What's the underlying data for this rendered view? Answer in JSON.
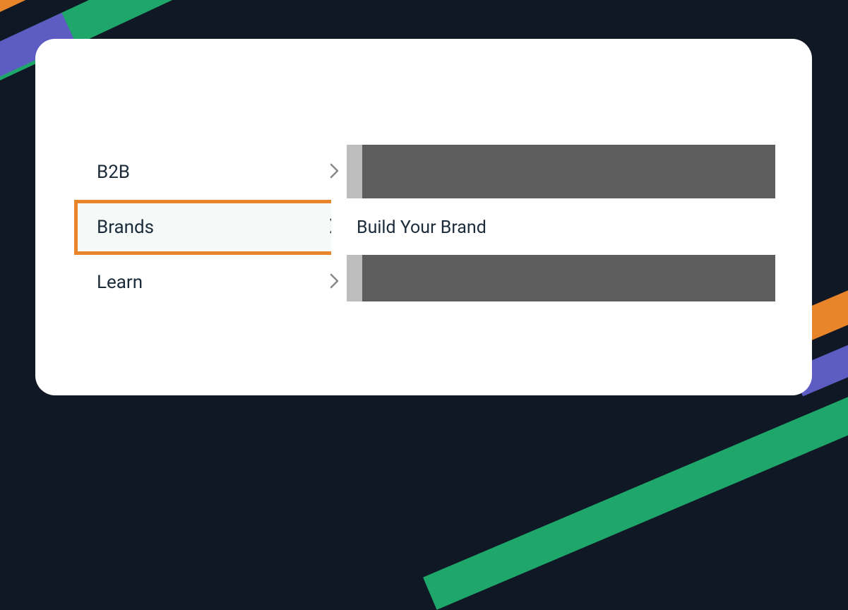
{
  "menu": {
    "items": [
      {
        "label": "B2B",
        "highlighted": false
      },
      {
        "label": "Brands",
        "highlighted": true
      },
      {
        "label": "Learn",
        "highlighted": false
      }
    ]
  },
  "submenu": {
    "active_label": "Build Your Brand"
  }
}
